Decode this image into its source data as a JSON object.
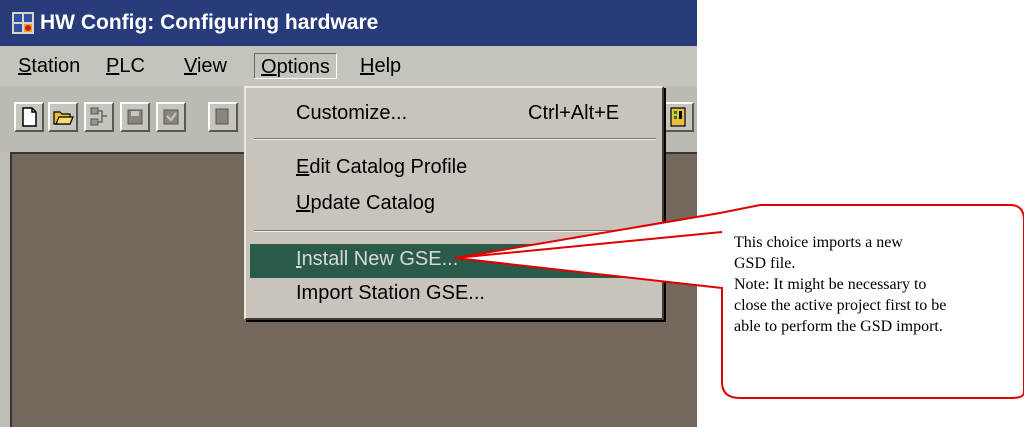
{
  "window": {
    "title": "HW Config: Configuring hardware",
    "app_icon": "hw-config-icon"
  },
  "menubar": {
    "items": [
      {
        "label": "Station"
      },
      {
        "label": "PLC"
      },
      {
        "label": "View"
      },
      {
        "label": "Options",
        "open": true
      },
      {
        "label": "Help"
      }
    ]
  },
  "toolbar": {
    "buttons": [
      "new-file-icon",
      "open-folder-icon",
      "network-icon",
      "save-icon",
      "save-compile-icon",
      "module-icon"
    ]
  },
  "options_menu": {
    "items": [
      {
        "label": "Customize...",
        "shortcut": "Ctrl+Alt+E"
      },
      {
        "label": "Edit Catalog Profile"
      },
      {
        "label": "Update Catalog"
      },
      {
        "label": "Install New GSE...",
        "highlighted": true
      },
      {
        "label": "Import Station GSE..."
      }
    ]
  },
  "callout": {
    "lines": [
      "This choice imports a new",
      "GSD file.",
      "Note: It might be necessary to",
      "close the active project first to be",
      "able to perform the GSD import."
    ],
    "border_color": "#e00000"
  },
  "colors": {
    "title_bar": "#283c7c",
    "highlight": "#2a5a4a",
    "workspace": "#74685c"
  }
}
